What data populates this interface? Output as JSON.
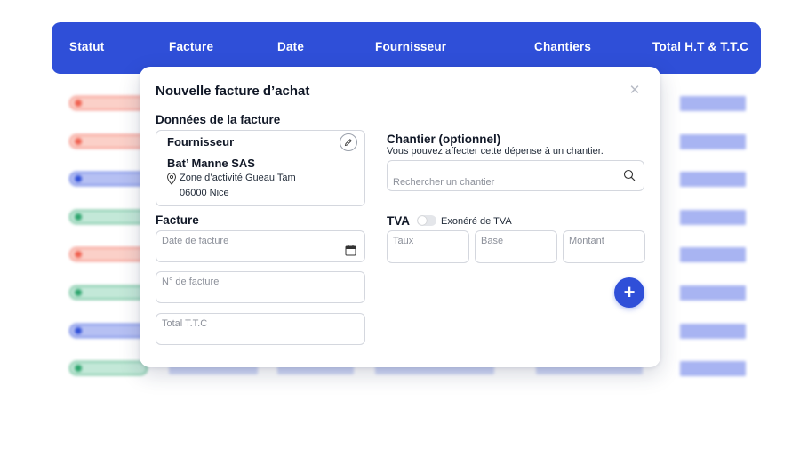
{
  "table": {
    "headers": [
      "Statut",
      "Facture",
      "Date",
      "Fournisseur",
      "Chantiers",
      "Total H.T & T.T.C"
    ],
    "rows": [
      {
        "status": "red"
      },
      {
        "status": "red"
      },
      {
        "status": "blue"
      },
      {
        "status": "green"
      },
      {
        "status": "red"
      },
      {
        "status": "green"
      },
      {
        "status": "blue"
      },
      {
        "status": "green"
      }
    ]
  },
  "colors": {
    "brand": "#2f4fd8",
    "status_red_fill": "#fbd0c8",
    "status_red_dot": "#f0604f",
    "status_blue_fill": "#b6c0f3",
    "status_blue_dot": "#2f4fd8",
    "status_green_fill": "#c3e8d8",
    "status_green_dot": "#2aa36b",
    "amount_bar": "#a8b4f2"
  },
  "modal": {
    "title": "Nouvelle facture d’achat",
    "close_icon": "close-icon",
    "invoice_data_title": "Données de la facture",
    "supplier": {
      "heading": "Fournisseur",
      "name": "Bat’ Manne SAS",
      "address_line1": "Zone d’activité Gueau Tam",
      "address_line2": "06000 Nice",
      "edit_icon": "pencil-icon",
      "location_icon": "location-pin-icon"
    },
    "facture_section": {
      "title": "Facture",
      "date_placeholder": "Date de facture",
      "number_placeholder": "N° de facture",
      "total_placeholder": "Total T.T.C",
      "calendar_icon": "calendar-icon"
    },
    "chantier": {
      "title": "Chantier (optionnel)",
      "subtitle": "Vous pouvez affecter cette dépense à un chantier.",
      "search_placeholder": "Rechercher un chantier",
      "search_icon": "search-icon"
    },
    "tva": {
      "title": "TVA",
      "toggle_label": "Exonéré de TVA",
      "toggle_on": false,
      "taux_placeholder": "Taux",
      "base_placeholder": "Base",
      "montant_placeholder": "Montant"
    },
    "add_button": "+"
  }
}
